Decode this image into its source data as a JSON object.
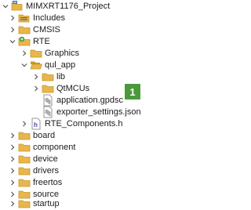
{
  "tree": {
    "project": {
      "label": "MIMXRT1176_Project",
      "icon": "project-icon"
    },
    "includes": {
      "label": "Includes",
      "icon": "includes-icon"
    },
    "cmsis": {
      "label": "CMSIS",
      "icon": "folder-icon"
    },
    "rte": {
      "label": "RTE",
      "icon": "rte-folder-icon"
    },
    "graphics": {
      "label": "Graphics",
      "icon": "folder-icon"
    },
    "qul_app": {
      "label": "qul_app",
      "icon": "folder-open-icon"
    },
    "lib": {
      "label": "lib",
      "icon": "folder-icon"
    },
    "qtmcus": {
      "label": "QtMCUs",
      "icon": "folder-icon"
    },
    "application_gpdsc": {
      "label": "application.gpdsc",
      "icon": "file-icon"
    },
    "exporter_settings": {
      "label": "exporter_settings.json",
      "icon": "file-icon"
    },
    "rte_components": {
      "label": "RTE_Components.h",
      "icon": "header-file-icon"
    },
    "board": {
      "label": "board",
      "icon": "folder-icon"
    },
    "component": {
      "label": "component",
      "icon": "folder-icon"
    },
    "device": {
      "label": "device",
      "icon": "folder-icon"
    },
    "drivers": {
      "label": "drivers",
      "icon": "folder-icon"
    },
    "freertos": {
      "label": "freertos",
      "icon": "folder-icon"
    },
    "source": {
      "label": "source",
      "icon": "folder-icon"
    },
    "startup": {
      "label": "startup",
      "icon": "folder-icon"
    }
  },
  "callout": {
    "number": "1",
    "color": "#4a9a3c"
  },
  "colors": {
    "folder": "#e8b64a",
    "folder_dark": "#c9952a",
    "chevron": "#555555"
  }
}
